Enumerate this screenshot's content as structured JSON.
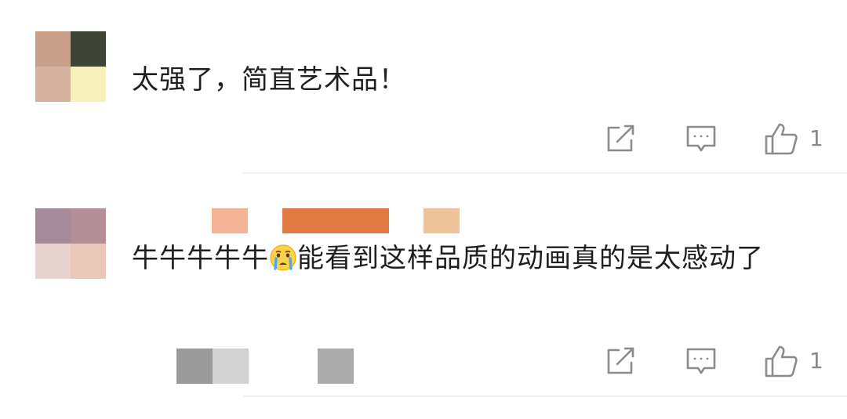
{
  "comments": [
    {
      "text": "太强了，简直艺术品！",
      "avatar_colors": [
        "#c9a18a",
        "#3f4536",
        "#d6b29e",
        "#f8f0bb"
      ],
      "icons": {
        "share": "share-icon",
        "comment": "comment-icon",
        "like": "like-icon"
      },
      "like_count": "1"
    },
    {
      "text_before_emoji": "牛牛牛牛牛",
      "emoji": "crying-face-emoji",
      "text_after_emoji": "能看到这样品质的动画真的是太感动了",
      "avatar_colors": [
        "#a58b9a",
        "#b48f98",
        "#e7d3d0",
        "#e9c8b9"
      ],
      "icons": {
        "share": "share-icon",
        "comment": "comment-icon",
        "like": "like-icon"
      },
      "like_count": "1"
    }
  ],
  "colors": {
    "icon": "#8c8c8c",
    "divider": "#f0f0f0",
    "text": "#1f1f1f"
  }
}
